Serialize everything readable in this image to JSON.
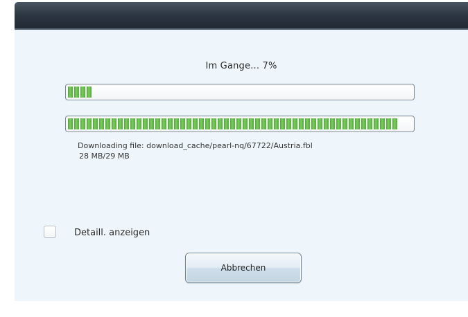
{
  "dialog": {
    "status_text": "Im Gange... 7%",
    "overall_progress": 0.07,
    "file_progress": 0.96,
    "file_label": "Downloading file: download_cache/pearl-nq/67722/Austria.fbl",
    "size_text": "28 MB/29 MB",
    "details_checkbox": {
      "label": "Detaill. anzeigen",
      "checked": false
    },
    "cancel_button_label": "Abbrechen"
  },
  "colors": {
    "titlebar": "#2d3742",
    "background": "#eef6fb",
    "progress_fill": "#5cb146"
  }
}
